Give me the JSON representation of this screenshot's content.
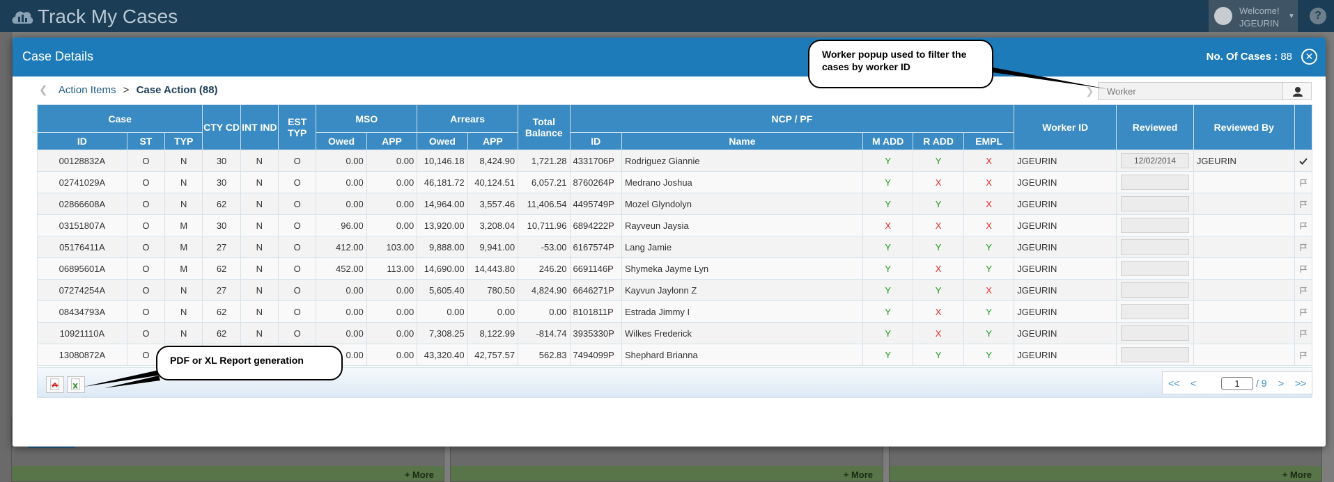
{
  "app": {
    "title": "Track My Cases",
    "welcome": "Welcome!",
    "user": "JGEURIN"
  },
  "background": {
    "more_label": "+ More"
  },
  "modal": {
    "title": "Case Details",
    "count_label": "No. Of Cases :",
    "count_value": "88",
    "breadcrumb": {
      "parent": "Action Items",
      "separator": ">",
      "current": "Case Action (88)"
    },
    "worker_filter": {
      "placeholder": "Worker"
    }
  },
  "table": {
    "group_headers": {
      "case": "Case",
      "cty_cd": "CTY CD",
      "int_ind": "INT IND",
      "est_typ": "EST TYP",
      "mso": "MSO",
      "arrears": "Arrears",
      "total_balance": "Total Balance",
      "ncp_pf": "NCP / PF",
      "worker_id": "Worker ID",
      "reviewed": "Reviewed",
      "reviewed_by": "Reviewed By"
    },
    "sub_headers": {
      "id": "ID",
      "st": "ST",
      "typ": "TYP",
      "owed": "Owed",
      "app": "APP",
      "ncp_id": "ID",
      "name": "Name",
      "m_add": "M ADD",
      "r_add": "R ADD",
      "empl": "EMPL"
    },
    "rows": [
      {
        "id": "00128832A",
        "st": "O",
        "typ": "N",
        "cty": "30",
        "int": "N",
        "est": "O",
        "mso_owed": "0.00",
        "mso_app": "0.00",
        "arr_owed": "10,146.18",
        "arr_app": "8,424.90",
        "total": "1,721.28",
        "ncp_id": "4331706P",
        "name": "Rodriguez Giannie",
        "m_add": "Y",
        "r_add": "Y",
        "empl": "X",
        "worker": "JGEURIN",
        "reviewed": "12/02/2014",
        "reviewed_by": "JGEURIN",
        "action": "check"
      },
      {
        "id": "02741029A",
        "st": "O",
        "typ": "N",
        "cty": "30",
        "int": "N",
        "est": "O",
        "mso_owed": "0.00",
        "mso_app": "0.00",
        "arr_owed": "46,181.72",
        "arr_app": "40,124.51",
        "total": "6,057.21",
        "ncp_id": "8760264P",
        "name": "Medrano Joshua",
        "m_add": "Y",
        "r_add": "X",
        "empl": "X",
        "worker": "JGEURIN",
        "reviewed": "",
        "reviewed_by": "",
        "action": "flag"
      },
      {
        "id": "02866608A",
        "st": "O",
        "typ": "N",
        "cty": "62",
        "int": "N",
        "est": "O",
        "mso_owed": "0.00",
        "mso_app": "0.00",
        "arr_owed": "14,964.00",
        "arr_app": "3,557.46",
        "total": "11,406.54",
        "ncp_id": "4495749P",
        "name": "Mozel Glyndolyn",
        "m_add": "Y",
        "r_add": "Y",
        "empl": "X",
        "worker": "JGEURIN",
        "reviewed": "",
        "reviewed_by": "",
        "action": "flag"
      },
      {
        "id": "03151807A",
        "st": "O",
        "typ": "M",
        "cty": "30",
        "int": "N",
        "est": "O",
        "mso_owed": "96.00",
        "mso_app": "0.00",
        "arr_owed": "13,920.00",
        "arr_app": "3,208.04",
        "total": "10,711.96",
        "ncp_id": "6894222P",
        "name": "Rayveun Jaysia",
        "m_add": "X",
        "r_add": "X",
        "empl": "X",
        "worker": "JGEURIN",
        "reviewed": "",
        "reviewed_by": "",
        "action": "flag"
      },
      {
        "id": "05176411A",
        "st": "O",
        "typ": "M",
        "cty": "27",
        "int": "N",
        "est": "O",
        "mso_owed": "412.00",
        "mso_app": "103.00",
        "arr_owed": "9,888.00",
        "arr_app": "9,941.00",
        "total": "-53.00",
        "ncp_id": "6167574P",
        "name": "Lang Jamie",
        "m_add": "Y",
        "r_add": "Y",
        "empl": "Y",
        "worker": "JGEURIN",
        "reviewed": "",
        "reviewed_by": "",
        "action": "flag"
      },
      {
        "id": "06895601A",
        "st": "O",
        "typ": "M",
        "cty": "62",
        "int": "N",
        "est": "O",
        "mso_owed": "452.00",
        "mso_app": "113.00",
        "arr_owed": "14,690.00",
        "arr_app": "14,443.80",
        "total": "246.20",
        "ncp_id": "6691146P",
        "name": "Shymeka Jayme Lyn",
        "m_add": "Y",
        "r_add": "X",
        "empl": "Y",
        "worker": "JGEURIN",
        "reviewed": "",
        "reviewed_by": "",
        "action": "flag"
      },
      {
        "id": "07274254A",
        "st": "O",
        "typ": "N",
        "cty": "27",
        "int": "N",
        "est": "O",
        "mso_owed": "0.00",
        "mso_app": "0.00",
        "arr_owed": "5,605.40",
        "arr_app": "780.50",
        "total": "4,824.90",
        "ncp_id": "6646271P",
        "name": "Kayvun Jaylonn Z",
        "m_add": "Y",
        "r_add": "Y",
        "empl": "X",
        "worker": "JGEURIN",
        "reviewed": "",
        "reviewed_by": "",
        "action": "flag"
      },
      {
        "id": "08434793A",
        "st": "O",
        "typ": "N",
        "cty": "62",
        "int": "N",
        "est": "O",
        "mso_owed": "0.00",
        "mso_app": "0.00",
        "arr_owed": "0.00",
        "arr_app": "0.00",
        "total": "0.00",
        "ncp_id": "8101811P",
        "name": "Estrada Jimmy I",
        "m_add": "Y",
        "r_add": "X",
        "empl": "Y",
        "worker": "JGEURIN",
        "reviewed": "",
        "reviewed_by": "",
        "action": "flag"
      },
      {
        "id": "10921110A",
        "st": "O",
        "typ": "N",
        "cty": "62",
        "int": "N",
        "est": "O",
        "mso_owed": "0.00",
        "mso_app": "0.00",
        "arr_owed": "7,308.25",
        "arr_app": "8,122.99",
        "total": "-814.74",
        "ncp_id": "3935330P",
        "name": "Wilkes Frederick",
        "m_add": "Y",
        "r_add": "X",
        "empl": "Y",
        "worker": "JGEURIN",
        "reviewed": "",
        "reviewed_by": "",
        "action": "flag"
      },
      {
        "id": "13080872A",
        "st": "O",
        "typ": "",
        "cty": "",
        "int": "",
        "est": "",
        "mso_owed": "0.00",
        "mso_app": "0.00",
        "arr_owed": "43,320.40",
        "arr_app": "42,757.57",
        "total": "562.83",
        "ncp_id": "7494099P",
        "name": "Shephard Brianna",
        "m_add": "Y",
        "r_add": "Y",
        "empl": "Y",
        "worker": "JGEURIN",
        "reviewed": "",
        "reviewed_by": "",
        "action": "flag"
      }
    ]
  },
  "pager": {
    "first": "<<",
    "prev": "<",
    "page": "1",
    "of": "/ 9",
    "next": ">",
    "last": ">>"
  },
  "callouts": {
    "worker": "Worker popup used to filter the cases by worker ID",
    "report": "PDF or XL Report generation"
  },
  "colors": {
    "header_blue": "#1e7bb9",
    "table_header": "#3a8bc4",
    "yes": "#1a9b1a",
    "no": "#e22b2b"
  }
}
